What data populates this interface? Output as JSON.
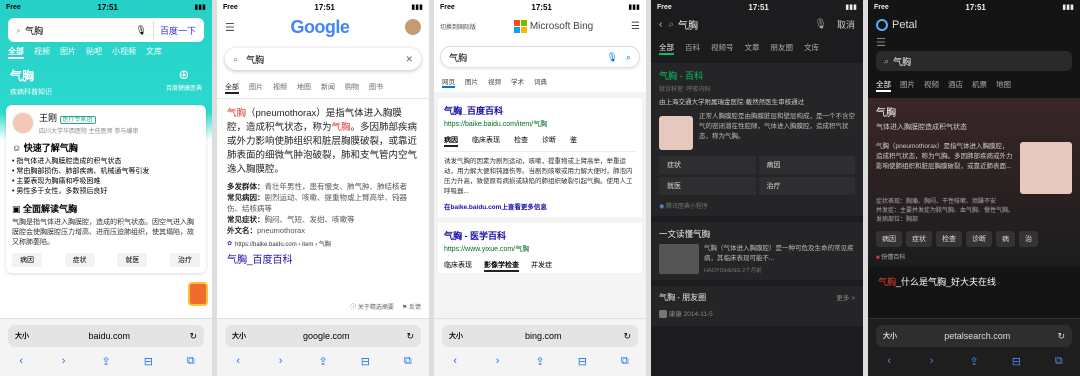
{
  "status": {
    "time": "17:51",
    "carrier": "Free",
    "battery": "■■"
  },
  "baidu": {
    "query": "气胸",
    "search_btn": "百度一下",
    "tabs": [
      "全部",
      "视频",
      "图片",
      "贴吧",
      "小视频",
      "文库"
    ],
    "title": "气胸",
    "subtitle": "疾病科普知识",
    "hospital_badge": "百度健康医典",
    "doctor_name": "王刚",
    "doctor_badge": "医疗专家团",
    "doctor_meta": "四川大学华西医院  主任医师  参与编审",
    "quick_title": "快速了解气胸",
    "quick_items": [
      "指气体进入胸膜腔造成的积气状态",
      "常由胸部损伤、肺部疾病、机械通气等引发",
      "主要表现为胸痛和呼吸困难",
      "男性多于女性，多数预后良好"
    ],
    "full_title": "全面解读气胸",
    "full_text": "气胸是指气体进入胸膜腔，造成的积气状态。因空气进入胸膜腔会使胸膜腔压力增高、进而压迫肺组织，使其塌陷，故又称肺萎陷。",
    "bottom_tabs": [
      "病因",
      "症状",
      "就医",
      "治疗"
    ],
    "domain": "baidu.com"
  },
  "google": {
    "logo": "Google",
    "query": "气胸",
    "tabs": [
      "全部",
      "图片",
      "视频",
      "地图",
      "新闻",
      "购物",
      "图书"
    ],
    "snippet_pre": "气胸",
    "snippet": "（pneumothorax）是指气体进入胸膜腔，造成积气状态，称为",
    "snippet_red": "气胸",
    "snippet_post": "。多因肺部疾病或外力影响使肺组织和脏层胸膜破裂，或靠近肺表面的细微气肿泡破裂，肺和支气管内空气逸入胸膜腔。",
    "facts": [
      {
        "k": "多发群体：",
        "v": "青壮年男性，患有慢支、肺气肿、肺结核者"
      },
      {
        "k": "常见病因：",
        "v": "剧烈运动、咳嗽、提重物或上臂高举、钝器伤、结核病等"
      },
      {
        "k": "常见症状：",
        "v": "胸闷、气短、发绀、咳嗽等"
      },
      {
        "k": "外文名：",
        "v": "pneumothorax"
      }
    ],
    "source": "https://baike.baidu.com › item › 气胸",
    "result_title": "气胸_百度百科",
    "footer_left": "关于精选摘要",
    "footer_right": "反馈",
    "domain": "google.com"
  },
  "bing": {
    "switch": "切换到国际版",
    "logo": "Microsoft Bing",
    "query": "气胸",
    "tabs": [
      "网页",
      "图片",
      "视频",
      "学术",
      "词典"
    ],
    "r1_title": "气胸_百度百科",
    "r1_url": "https://baike.baidu.com/item/气胸",
    "r1_tabs": [
      "病因",
      "临床表现",
      "检查",
      "诊断",
      "鉴"
    ],
    "r1_text": "诱发气胸的因素为剧烈运动，咳嗽，提重物或上臂高举，举重运动，用力解大便和钝器伤等。当剧烈咳嗽或用力解大便时，肺泡内压力升高，致使原有病损或缺陷的肺组织破裂引起气胸。使用人工呼吸器...",
    "r1_more": "在baike.baidu.com上查看更多信息",
    "r2_title": "气胸 - 医学百科",
    "r2_url": "https://www.yixue.com/气胸",
    "r2_tabs": [
      "临床表现",
      "影像学检查",
      "并发症"
    ],
    "domain": "bing.com"
  },
  "weixin": {
    "query": "气胸",
    "cancel": "取消",
    "tabs": [
      "全部",
      "百科",
      "视频号",
      "文章",
      "朋友圈",
      "文库"
    ],
    "title": "气胸 - 百科",
    "subtitle": "就诊科室: 呼吸内科",
    "source": "由上海交通大学附属瑞金医院·戴然然医生审核通过",
    "desc": "正常人胸膜腔是由胸膜脏层和壁层构成，是一个不含空气的密闭潜在性腔隙，气体进入胸膜腔，造成积气状态，称为气胸。",
    "grid": [
      "症状",
      "病因",
      "就医",
      "治疗"
    ],
    "mini": "腾讯医典小程序",
    "article_title": "一文读懂气胸",
    "article_text": "气胸（气体进入胸膜腔）是一种可危及生命的常见疾病，其临床表现可能不...",
    "article_meta": "HAOYISHENG  2个月前",
    "moments": "气胸 - 朋友圈",
    "more": "更多 >",
    "moment_user": "康康",
    "moment_date": "2014-11-5",
    "domain": ""
  },
  "petal": {
    "logo": "Petal",
    "query": "气胸",
    "tabs": [
      "全部",
      "图片",
      "视频",
      "酒店",
      "机票",
      "地图"
    ],
    "title": "气胸",
    "subtitle": "气体进入胸膜腔造成积气状态",
    "desc": "气胸（pneumothorax）是指气体进入胸膜腔，造成积气状态，称为气胸。多因肺部疾病或外力影响使肺组织和脏层胸膜破裂，或靠近肺表面...",
    "facts": [
      "症状表现：胸痛、胸闷、干性咳嗽、烦躁不安",
      "并发症：主要并发症为脓气胸、血气胸、慢性气胸。",
      "发病部位：胸部"
    ],
    "chips": [
      "病因",
      "症状",
      "检查",
      "诊断",
      "病",
      "治"
    ],
    "src": "快懂百科",
    "link": "_什么是气胸_好大夫在线",
    "domain": "petalsearch.com"
  }
}
